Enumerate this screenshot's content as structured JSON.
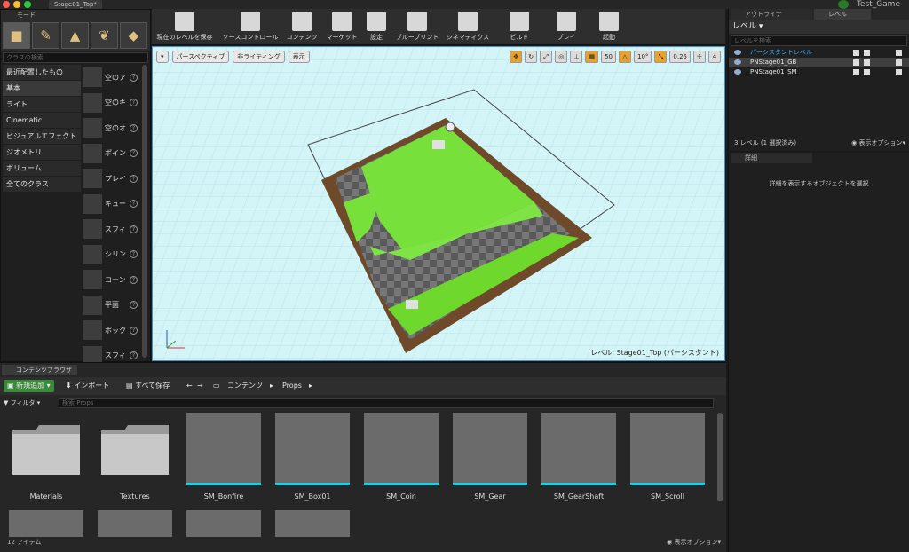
{
  "window": {
    "tab_title": "Stage01_Top*",
    "project_name": "Test_Game"
  },
  "modes": {
    "tab_label": "モード",
    "search_placeholder": "クラスの検索",
    "categories": [
      "最近配置したもの",
      "基本",
      "ライト",
      "Cinematic",
      "ビジュアルエフェクト",
      "ジオメトリ",
      "ボリューム",
      "全てのクラス"
    ],
    "items": [
      "空のア",
      "空のキ",
      "空のオ",
      "ポイン",
      "プレイ",
      "キュー",
      "スフィ",
      "シリン",
      "コーン",
      "平面",
      "ボック",
      "スフィ"
    ]
  },
  "toolbar": [
    "現在のレベルを保存",
    "ソースコントロール",
    "コンテンツ",
    "マーケット",
    "設定",
    "ブループリント",
    "シネマティクス",
    "ビルド",
    "プレイ",
    "起動"
  ],
  "viewport": {
    "perspective_label": "パースペクティブ",
    "lighting_label": "非ライティング",
    "show_label": "表示",
    "grid_snap": "50",
    "rot_snap": "10°",
    "scale_snap": "0.25",
    "cam_speed": "4",
    "status": "レベル: Stage01_Top (パーシスタント)"
  },
  "outliner": {
    "tab_outliner": "アウトライナ",
    "tab_levels": "レベル",
    "levels_title": "レベル",
    "search_placeholder": "レベルを検索",
    "levels": [
      {
        "name": "パーシスタントレベル",
        "color": "#2fb0ff"
      },
      {
        "name": "PNStage01_GB",
        "color": "#e8e8e8"
      },
      {
        "name": "PNStage01_SM",
        "color": "#e8e8e8"
      }
    ],
    "count": "3 レベル (1 選択済み)",
    "view_options": "表示オプション"
  },
  "details": {
    "tab": "詳細",
    "empty": "詳細を表示するオブジェクトを選択"
  },
  "content": {
    "tab": "コンテンツブラウザ",
    "add_new": "新規追加",
    "import": "インポート",
    "save_all": "すべて保存",
    "path": [
      "コンテンツ",
      "Props"
    ],
    "filter": "フィルタ",
    "search_placeholder": "検索 Props",
    "assets": [
      "Materials",
      "Textures",
      "SM_Bonfire",
      "SM_Box01",
      "SM_Coin",
      "SM_Gear",
      "SM_GearShaft",
      "SM_Scroll"
    ],
    "count": "12 アイテム",
    "view_options": "表示オプション"
  }
}
